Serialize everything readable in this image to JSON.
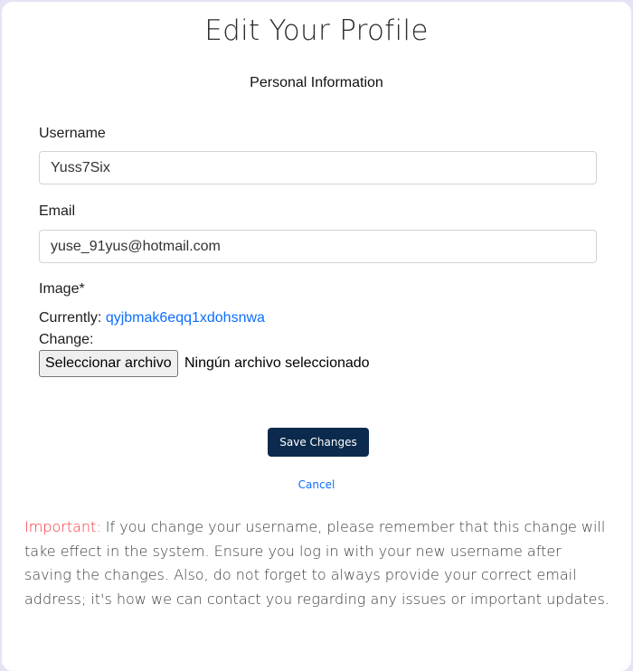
{
  "page": {
    "title": "Edit Your Profile",
    "section_title": "Personal Information"
  },
  "form": {
    "username": {
      "label": "Username",
      "value": "Yuss7Six"
    },
    "email": {
      "label": "Email",
      "value": "yuse_91yus@hotmail.com"
    },
    "image": {
      "label": "Image*",
      "currently_label": "Currently:",
      "current_file": "qyjbmak6eqq1xdohsnwa",
      "change_label": "Change:",
      "file_button_label": "Seleccionar archivo",
      "file_status": "Ningún archivo seleccionado"
    }
  },
  "actions": {
    "save_label": "Save Changes",
    "cancel_label": "Cancel"
  },
  "notice": {
    "prefix": "Important:",
    "text": " If you change your username, please remember that this change will take effect in the system. Ensure you log in with your new username after saving the changes. Also, do not forget to always provide your correct email address; it's how we can contact you regarding any issues or important updates."
  },
  "colors": {
    "save_button": "#0c2a4d",
    "link": "#0d6efd",
    "important": "#f5333f"
  }
}
